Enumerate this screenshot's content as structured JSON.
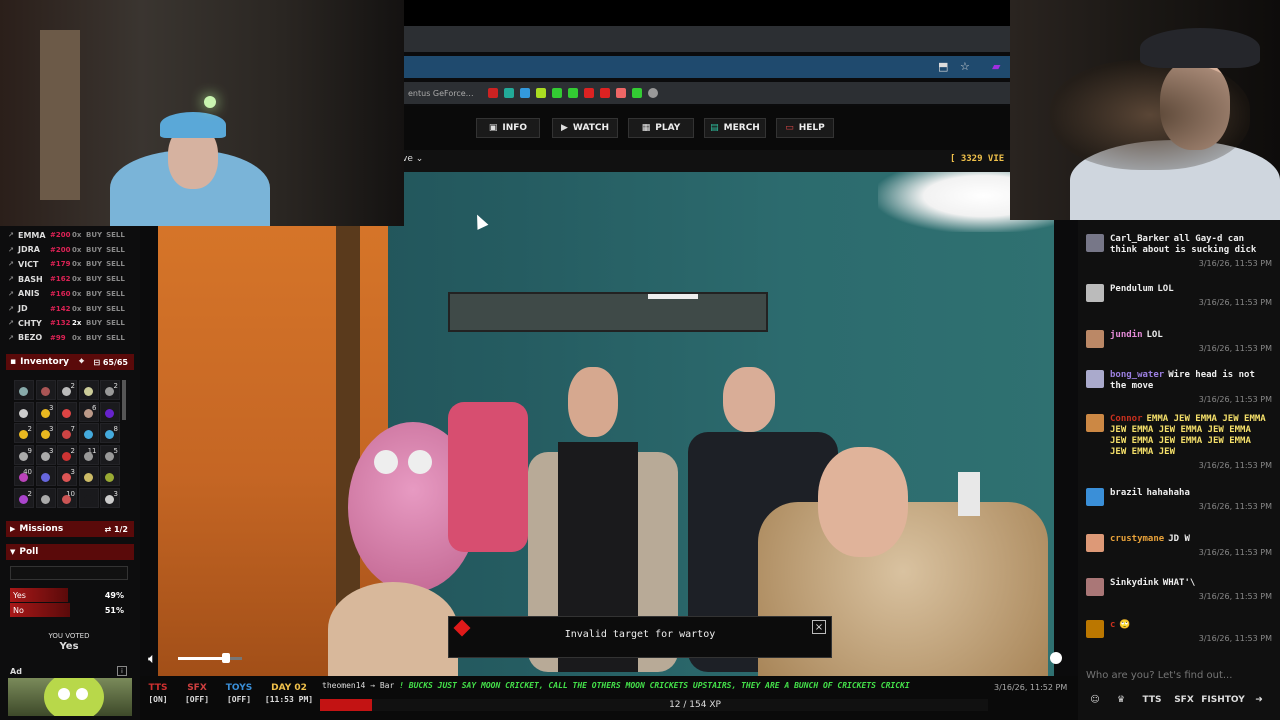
{
  "nav": {
    "info": "INFO",
    "watch": "WATCH",
    "play": "PLAY",
    "merch": "MERCH",
    "help": "HELP"
  },
  "bookmarks_text": "entus GeForce…",
  "subbar": {
    "live_select": "ve",
    "views": "[ 3329 VIE"
  },
  "stocks": [
    {
      "name": "EMMA",
      "price": "#200",
      "qty": "0x",
      "buy": "BUY",
      "sell": "SELL"
    },
    {
      "name": "JDRA",
      "price": "#200",
      "qty": "0x",
      "buy": "BUY",
      "sell": "SELL"
    },
    {
      "name": "VICT",
      "price": "#179",
      "qty": "0x",
      "buy": "BUY",
      "sell": "SELL"
    },
    {
      "name": "BASH",
      "price": "#162",
      "qty": "0x",
      "buy": "BUY",
      "sell": "SELL"
    },
    {
      "name": "ANIS",
      "price": "#160",
      "qty": "0x",
      "buy": "BUY",
      "sell": "SELL"
    },
    {
      "name": "JD",
      "price": "#142",
      "qty": "0x",
      "buy": "BUY",
      "sell": "SELL"
    },
    {
      "name": "CHTY",
      "price": "#132",
      "qty": "2x",
      "buy": "BUY",
      "sell": "SELL"
    },
    {
      "name": "BEZO",
      "price": "#99",
      "qty": "0x",
      "buy": "BUY",
      "sell": "SELL"
    }
  ],
  "inventory": {
    "title": "Inventory",
    "count": "65/65",
    "slots": [
      {
        "badge": "",
        "color": "#8aa"
      },
      {
        "badge": "",
        "color": "#a55"
      },
      {
        "badge": "2",
        "color": "#bbb"
      },
      {
        "badge": "",
        "color": "#cc9"
      },
      {
        "badge": "2",
        "color": "#999"
      },
      {
        "badge": "",
        "color": "#ccc"
      },
      {
        "badge": "3",
        "color": "#e9b820"
      },
      {
        "badge": "",
        "color": "#d44"
      },
      {
        "badge": "6",
        "color": "#b98"
      },
      {
        "badge": "",
        "color": "#62c"
      },
      {
        "badge": "2",
        "color": "#e9b820"
      },
      {
        "badge": "3",
        "color": "#e9b820"
      },
      {
        "badge": "7",
        "color": "#c44"
      },
      {
        "badge": "",
        "color": "#4ad"
      },
      {
        "badge": "8",
        "color": "#4ad"
      },
      {
        "badge": "9",
        "color": "#aaa"
      },
      {
        "badge": "3",
        "color": "#aaa"
      },
      {
        "badge": "2",
        "color": "#c33"
      },
      {
        "badge": "11",
        "color": "#999"
      },
      {
        "badge": "5",
        "color": "#999"
      },
      {
        "badge": "40",
        "color": "#b4b"
      },
      {
        "badge": "",
        "color": "#66d"
      },
      {
        "badge": "3",
        "color": "#d55"
      },
      {
        "badge": "",
        "color": "#cb6"
      },
      {
        "badge": "",
        "color": "#9a3"
      },
      {
        "badge": "2",
        "color": "#a4c"
      },
      {
        "badge": "",
        "color": "#aaa"
      },
      {
        "badge": "10",
        "color": "#c55"
      },
      {
        "badge": "",
        "color": "#1a1a1d"
      },
      {
        "badge": "3",
        "color": "#ccc"
      }
    ]
  },
  "missions": {
    "title": "Missions",
    "count": "1/2"
  },
  "poll": {
    "title": "Poll",
    "options": [
      {
        "label": "Yes",
        "pct": "49%",
        "fill": 0.49
      },
      {
        "label": "No",
        "pct": "51%",
        "fill": 0.51
      }
    ],
    "voted_label": "YOU VOTED",
    "voted_value": "Yes"
  },
  "ad": {
    "label": "Ad",
    "info": "i"
  },
  "toast": {
    "text": "Invalid target for wartoy",
    "close": "×"
  },
  "status": {
    "tts": {
      "label": "TTS",
      "state": "[ON]"
    },
    "sfx": {
      "label": "SFX",
      "state": "[OFF]"
    },
    "toys": {
      "label": "TOYS",
      "state": "[OFF]"
    },
    "day": {
      "label": "DAY 02",
      "time": "[11:53 PM]"
    }
  },
  "ticker": {
    "user": "theomen14",
    "arrow": "→",
    "target": "Bar",
    "message": "! BUCKS JUST SAY MOON CRICKET, CALL THE OTHERS MOON CRICKETS UPSTAIRS, THEY ARE A BUNCH OF CRICKETS CRICKI",
    "time": "3/16/26, 11:52 PM"
  },
  "xp": {
    "text": "12 / 154 XP",
    "fraction": 0.078
  },
  "chat": [
    {
      "user": "Carl_Barker",
      "color": "#eee",
      "text": "all Gay-d can think about is sucking dick",
      "ts": "3/16/26, 11:53 PM",
      "av": "#778"
    },
    {
      "user": "Pendulum",
      "color": "#eee",
      "text": "LOL",
      "ts": "3/16/26, 11:53 PM",
      "av": "#bbb"
    },
    {
      "user": "jundin",
      "color": "#e58bd8",
      "text": "LOL",
      "ts": "3/16/26, 11:53 PM",
      "av": "#b86"
    },
    {
      "user": "bong_water",
      "color": "#9b7fe0",
      "text": "Wire head is not the move",
      "ts": "3/16/26, 11:53 PM",
      "av": "#aac"
    },
    {
      "user": "Connor",
      "color": "#c9301e",
      "text": "EMMA JEW EMMA JEW EMMA JEW EMMA JEW EMMA JEW EMMA JEW EMMA JEW EMMA JEW EMMA JEW EMMA JEW",
      "ts": "3/16/26, 11:53 PM",
      "av": "#c84",
      "textcolor": "#f5e06a"
    },
    {
      "user": "brazil",
      "color": "#eee",
      "text": "hahahaha",
      "ts": "3/16/26, 11:53 PM",
      "av": "#3a8fd8"
    },
    {
      "user": "crustymane",
      "color": "#e8a23a",
      "text": "JD W",
      "ts": "3/16/26, 11:53 PM",
      "av": "#d97"
    },
    {
      "user": "Sinkydink",
      "color": "#eee",
      "text": "WHAT'\\",
      "ts": "3/16/26, 11:53 PM",
      "av": "#a77"
    },
    {
      "user": "c",
      "color": "#c9301e",
      "text": "🙄",
      "ts": "3/16/26, 11:53 PM",
      "av": "#b70"
    }
  ],
  "chat_input": {
    "placeholder": "Who are you? Let's find out..."
  },
  "chat_buttons": {
    "tts": "TTS",
    "sfx": "SFX",
    "fishtoy": "FISHTOY"
  }
}
